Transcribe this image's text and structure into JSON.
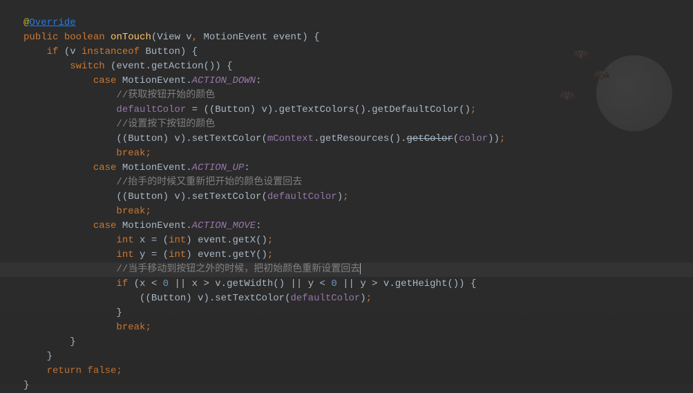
{
  "code": {
    "line1": {
      "at": "@",
      "override": "Override"
    },
    "line2": {
      "kw_public": "public",
      "kw_boolean": "boolean",
      "method": "onTouch",
      "params": "(View v",
      "comma": ",",
      "params2": " MotionEvent event)",
      "brace": " {"
    },
    "line3": {
      "kw_if": "if",
      "text": " (v ",
      "kw_instanceof": "instanceof",
      "text2": " Button) {"
    },
    "line4": {
      "kw_switch": "switch",
      "text": " (event.getAction()) {"
    },
    "line5": {
      "kw_case": "case",
      "text": " MotionEvent.",
      "const": "ACTION_DOWN",
      "colon": ":"
    },
    "line6": {
      "comment": "//获取按钮开始的颜色"
    },
    "line7": {
      "field": "defaultColor",
      "text": " = ((Button) v).getTextColors().getDefaultColor()",
      "semi": ";"
    },
    "line8": {
      "comment": "//设置按下按钮的颜色"
    },
    "line9": {
      "text": "((Button) v).setTextColor(",
      "field": "mContext",
      "text2": ".getResources().",
      "strike": "getColor",
      "text3": "(",
      "field2": "color",
      "text4": "))",
      "semi": ";"
    },
    "line10": {
      "kw_break": "break",
      "semi": ";"
    },
    "line11": {
      "kw_case": "case",
      "text": " MotionEvent.",
      "const": "ACTION_UP",
      "colon": ":"
    },
    "line12": {
      "comment": "//抬手的时候又重新把开始的颜色设置回去"
    },
    "line13": {
      "text": "((Button) v).setTextColor(",
      "field": "defaultColor",
      "text2": ")",
      "semi": ";"
    },
    "line14": {
      "kw_break": "break",
      "semi": ";"
    },
    "line15": {
      "kw_case": "case",
      "text": " MotionEvent.",
      "const": "ACTION_MOVE",
      "colon": ":"
    },
    "line16": {
      "kw_int": "int",
      "text": " x = (",
      "kw_int2": "int",
      "text2": ") event.getX()",
      "semi": ";"
    },
    "line17": {
      "kw_int": "int",
      "text": " y = (",
      "kw_int2": "int",
      "text2": ") event.getY()",
      "semi": ";"
    },
    "line18": {
      "comment": "//当手移动到按钮之外的时候，把初始颜色重新设置回去"
    },
    "line19": {
      "kw_if": "if",
      "text": " (x < ",
      "num1": "0",
      "text2": " || x > v.getWidth() || y < ",
      "num2": "0",
      "text3": " || y > v.getHeight()) {"
    },
    "line20": {
      "text": "((Button) v).setTextColor(",
      "field": "defaultColor",
      "text2": ")",
      "semi": ";"
    },
    "line21": {
      "brace": "}"
    },
    "line22": {
      "kw_break": "break",
      "semi": ";"
    },
    "line23": {
      "brace": "}"
    },
    "line24": {
      "brace": "}"
    },
    "line25": {
      "kw_return": "return",
      "kw_false": " false",
      "semi": ";"
    },
    "line26": {
      "brace": "}"
    }
  }
}
